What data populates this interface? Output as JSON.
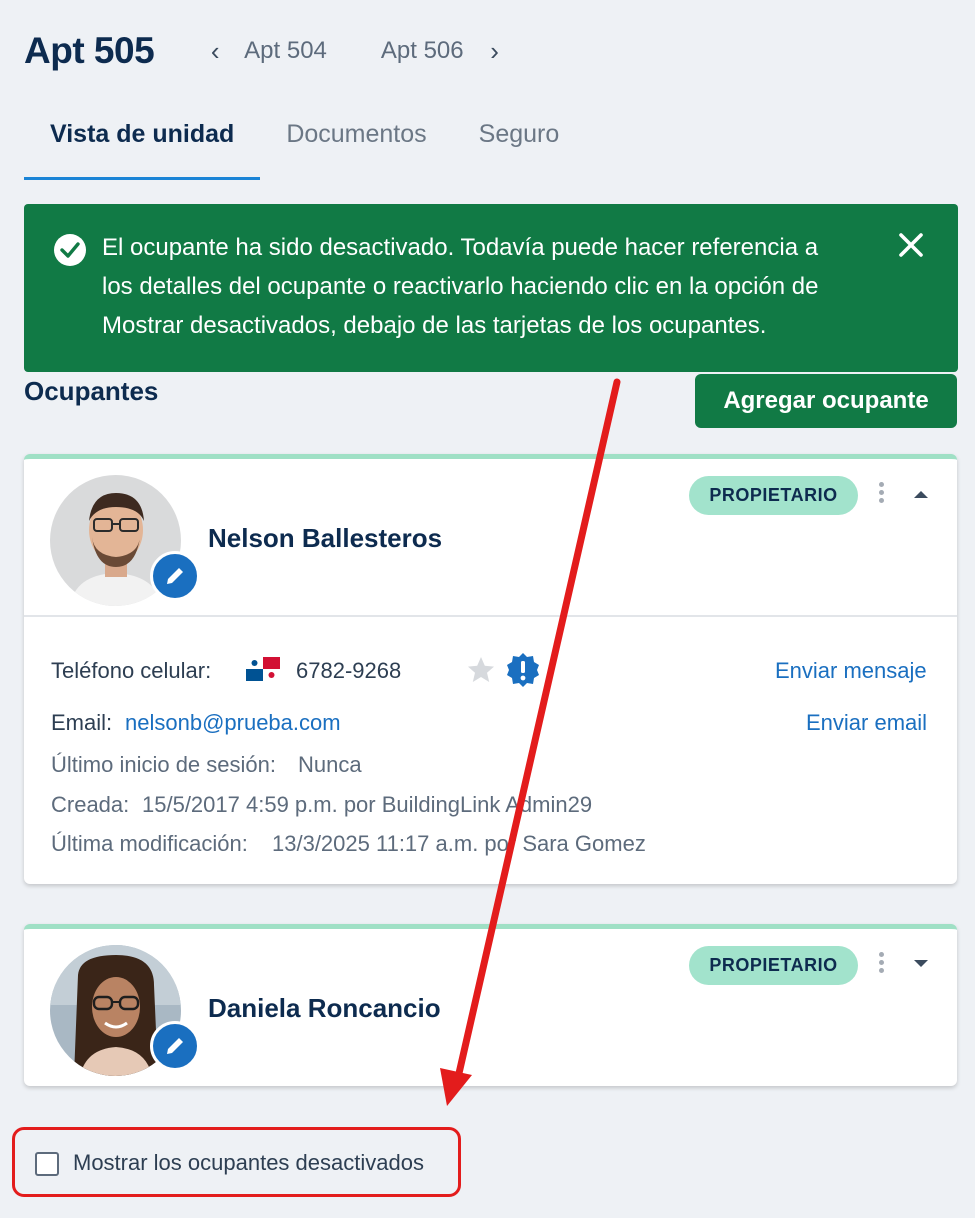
{
  "header": {
    "title": "Apt 505",
    "prev_unit": "Apt 504",
    "next_unit": "Apt 506"
  },
  "tabs": [
    {
      "label": "Vista de unidad",
      "active": true
    },
    {
      "label": "Documentos",
      "active": false
    },
    {
      "label": "Seguro",
      "active": false
    }
  ],
  "banner": {
    "lines": [
      "El ocupante ha sido desactivado. Todavía puede hacer referencia a",
      "los detalles del ocupante o reactivarlo haciendo clic en la opción de",
      "Mostrar desactivados, debajo de las tarjetas de los ocupantes."
    ],
    "color": "#117a45"
  },
  "occupants_section": {
    "title": "Ocupantes",
    "add_label": "Agregar ocupante"
  },
  "occupants": [
    {
      "name": "Nelson Ballesteros",
      "role": "PROPIETARIO",
      "expanded": true,
      "phone_label": "Teléfono celular:",
      "phone": "6782-9268",
      "send_message": "Enviar mensaje",
      "email_label": "Email:",
      "email": "nelsonb@prueba.com",
      "send_email": "Enviar email",
      "last_login_label": "Último inicio de sesión:",
      "last_login": "Nunca",
      "created_label": "Creada:",
      "created": "15/5/2017 4:59 p.m. por BuildingLink Admin29",
      "modified_label": "Última modificación:",
      "modified": "13/3/2025 11:17 a.m. por Sara Gomez"
    },
    {
      "name": "Daniela Roncancio",
      "role": "PROPIETARIO",
      "expanded": false
    }
  ],
  "show_deactivated": {
    "label": "Mostrar los ocupantes desactivados",
    "checked": false
  },
  "colors": {
    "primary_green": "#117a45",
    "badge_green": "#a2e3cc",
    "link_blue": "#1a6fc0",
    "highlight_red": "#e31c1c"
  }
}
